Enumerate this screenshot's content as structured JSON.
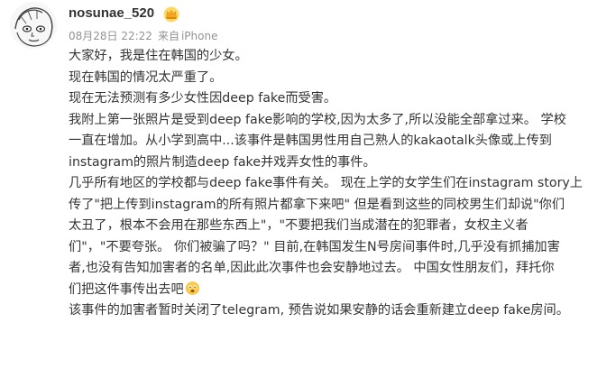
{
  "user": {
    "name": "nosunae_520",
    "badge_icon": "vip-crown-icon"
  },
  "meta": {
    "time": "08月28日 22:22",
    "from_label": "来自",
    "device": "iPhone"
  },
  "post": {
    "lines": [
      "大家好，我是住在韩国的少女。",
      "现在韩国的情况太严重了。",
      "现在无法预测有多少女性因deep fake而受害。",
      "我附上第一张照片是受到deep fake影响的学校,因为太多了,所以没能全部拿过来。 学校",
      "一直在增加。从小学到高中...该事件是韩国男性用自己熟人的kakaotalk头像或上传到",
      "instagram的照片制造deep fake并戏弄女性的事件。",
      "几乎所有地区的学校都与deep fake事件有关。 现在上学的女学生们在instagram story上",
      "传了\"把上传到instagram的所有照片都拿下来吧\" 但是看到这些的同校男生们却说\"你们",
      "太丑了，根本不会用在那些东西上\"，\"不要把我们当成潜在的犯罪者，女权主义者",
      "们\"，\"不要夸张。 你们被骗了吗？\" 目前,在韩国发生N号房间事件时,几乎没有抓捕加害",
      "者,也没有告知加害者的名单,因此此次事件也会安静地过去。 中国女性朋友们，拜托你",
      "们把这件事传出去吧",
      "该事件的加害者暂时关闭了telegram, 预告说如果安静的话会重新建立deep fake房间。"
    ],
    "emoji_icon": "sad-face-emoji-icon"
  },
  "colors": {
    "text": "#333333",
    "meta": "#939393",
    "badge": "#f5a623"
  }
}
